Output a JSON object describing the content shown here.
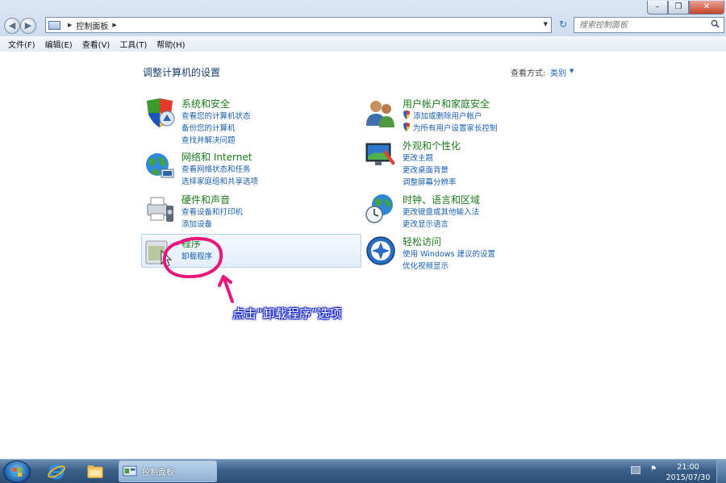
{
  "window": {
    "address_segment": "控制面板",
    "search_placeholder": "搜索控制面板",
    "buttons": {
      "minimize": "–",
      "maximize": "❐",
      "close": "✕"
    }
  },
  "menu": [
    "文件(F)",
    "编辑(E)",
    "查看(V)",
    "工具(T)",
    "帮助(H)"
  ],
  "page": {
    "title": "调整计算机的设置",
    "view_label": "查看方式:",
    "view_value": "类别"
  },
  "categories": {
    "system": {
      "title": "系统和安全",
      "links": [
        "查看您的计算机状态",
        "备份您的计算机",
        "查找并解决问题"
      ]
    },
    "network": {
      "title": "网络和 Internet",
      "links": [
        "查看网络状态和任务",
        "选择家庭组和共享选项"
      ]
    },
    "hardware": {
      "title": "硬件和声音",
      "links": [
        "查看设备和打印机",
        "添加设备"
      ]
    },
    "programs": {
      "title": "程序",
      "links": [
        "卸载程序"
      ]
    },
    "users": {
      "title": "用户帐户和家庭安全",
      "links": [
        "添加或删除用户帐户",
        "为所有用户设置家长控制"
      ]
    },
    "appearance": {
      "title": "外观和个性化",
      "links": [
        "更改主题",
        "更改桌面背景",
        "调整屏幕分辨率"
      ]
    },
    "clock": {
      "title": "时钟、语言和区域",
      "links": [
        "更改键盘或其他输入法",
        "更改显示语言"
      ]
    },
    "ease": {
      "title": "轻松访问",
      "links": [
        "使用 Windows 建议的设置",
        "优化视频显示"
      ]
    }
  },
  "annotation": "点击“卸载程序”选项",
  "taskbar": {
    "window_label": "控制面板",
    "time": "21:00",
    "date": "2015/07/30"
  },
  "colors": {
    "accent": "#1a5fb0",
    "category_title": "#1e7a1e",
    "annotation": "#e8177a"
  }
}
